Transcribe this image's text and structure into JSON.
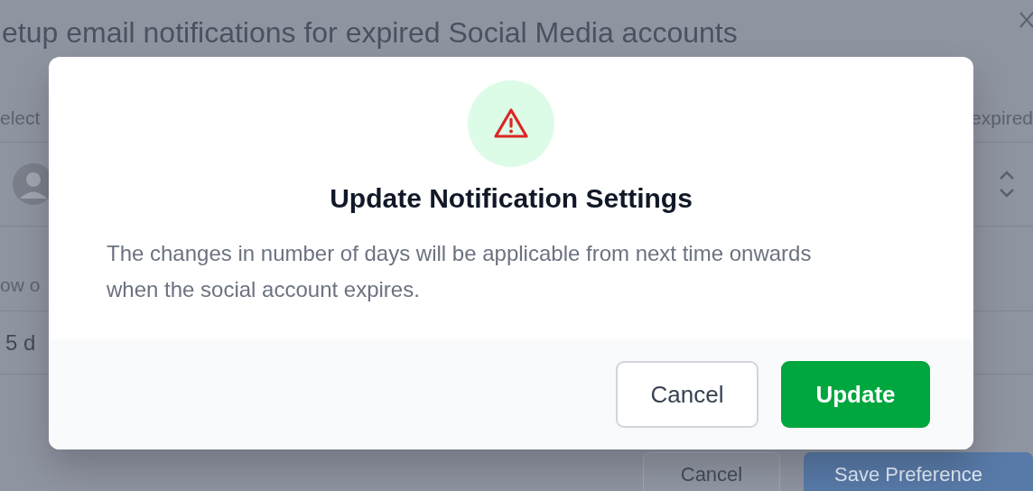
{
  "background": {
    "title": "etup email notifications for expired Social Media accounts",
    "header": {
      "column_1": "elect",
      "column_2": "expired"
    },
    "field_label": "ow o",
    "field_value": "5 d",
    "buttons": [
      {
        "label": "Cancel",
        "kind": "secondary"
      },
      {
        "label": "Save Preference",
        "kind": "primary"
      }
    ]
  },
  "dialog": {
    "title": "Update Notification Settings",
    "message": "The changes in number of days will be applicable from next time onwards when the social account expires.",
    "buttons": [
      {
        "label": "Cancel",
        "kind": "secondary"
      },
      {
        "label": "Update",
        "kind": "primary"
      }
    ]
  }
}
